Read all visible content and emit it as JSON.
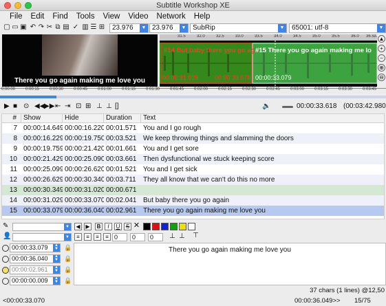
{
  "window": {
    "title": "Subtitle Workshop XE"
  },
  "menu": [
    "File",
    "Edit",
    "Find",
    "Tools",
    "View",
    "Video",
    "Network",
    "Help"
  ],
  "toolbar": {
    "fps1": "23.976",
    "fps2": "23.976",
    "format": "SubRip",
    "encoding": "65001: utf-8"
  },
  "video": {
    "subtitle": "There you go again making me love you"
  },
  "waveform": {
    "ruler": [
      "31.5",
      "32.0",
      "32.5",
      "33.0",
      "33.5",
      "34.0",
      "34.5",
      "35.0",
      "35.5",
      "36.0",
      "36.5",
      "37"
    ],
    "block14": {
      "label": "#14 But baby there you go aga",
      "start": "00:00:31.029",
      "end": "00:00:33.070"
    },
    "block15": {
      "label": "#15 There you go again making me lo",
      "start": "00:00:33.079"
    }
  },
  "timeline": [
    "0:00:00",
    "0:00:15",
    "0:00:30",
    "0:00:45",
    "0:01:00",
    "0:01:15",
    "0:01:30",
    "0:01:45",
    "0:02:00",
    "0:02:15",
    "0:02:30",
    "0:02:45",
    "0:03:00",
    "0:03:15",
    "0:03:30",
    "0:03:45"
  ],
  "player": {
    "position": "00:00:33.618",
    "duration": "(00:03:42.980)"
  },
  "grid": {
    "headers": [
      "#",
      "Show",
      "Hide",
      "Duration",
      "Text"
    ],
    "rows": [
      {
        "n": "7",
        "show": "00:00:14.649",
        "hide": "00:00:16.220",
        "dur": "00:01.571",
        "text": "You and I go rough"
      },
      {
        "n": "8",
        "show": "00:00:16.229",
        "hide": "00:00:19.750",
        "dur": "00:03.521",
        "text": "We keep throwing things and slamming the doors"
      },
      {
        "n": "9",
        "show": "00:00:19.759",
        "hide": "00:00:21.420",
        "dur": "00:01.661",
        "text": "You and I get sore"
      },
      {
        "n": "10",
        "show": "00:00:21.429",
        "hide": "00:00:25.090",
        "dur": "00:03.661",
        "text": "Then dysfunctional we stuck keeping score"
      },
      {
        "n": "11",
        "show": "00:00:25.099",
        "hide": "00:00:26.620",
        "dur": "00:01.521",
        "text": "You and I get sick"
      },
      {
        "n": "12",
        "show": "00:00:26.629",
        "hide": "00:00:30.340",
        "dur": "00:03.711",
        "text": "They all know that we can't do this no more"
      },
      {
        "n": "13",
        "show": "00:00:30.349",
        "hide": "00:00:31.020",
        "dur": "00:00.671",
        "text": ""
      },
      {
        "n": "14",
        "show": "00:00:31.029",
        "hide": "00:00:33.070",
        "dur": "00:02.041",
        "text": "But baby there you go again"
      },
      {
        "n": "15",
        "show": "00:00:33.079",
        "hide": "00:00:36.040",
        "dur": "00:02.961",
        "text": "There you go again making me love you"
      }
    ]
  },
  "editor": {
    "show": "00:00:33.079",
    "hide": "00:00:36.040",
    "duration": "00:00:02.961",
    "pause": "00:00:00.009",
    "nums": [
      "0",
      "0",
      "0"
    ],
    "text": "There you go again making me love you",
    "chars": "37 chars (1 lines) @12,50"
  },
  "colors": {
    "swatches": [
      "#000000",
      "#e01010",
      "#1020e0",
      "#10a010",
      "#f0e000",
      "#ffffff"
    ],
    "selected_row": "#b7c9ef",
    "green_row": "#d4e8d2"
  },
  "status": {
    "left": "<00:00:33.070",
    "mid": "00:00:36.049>>",
    "right": "15/75"
  }
}
